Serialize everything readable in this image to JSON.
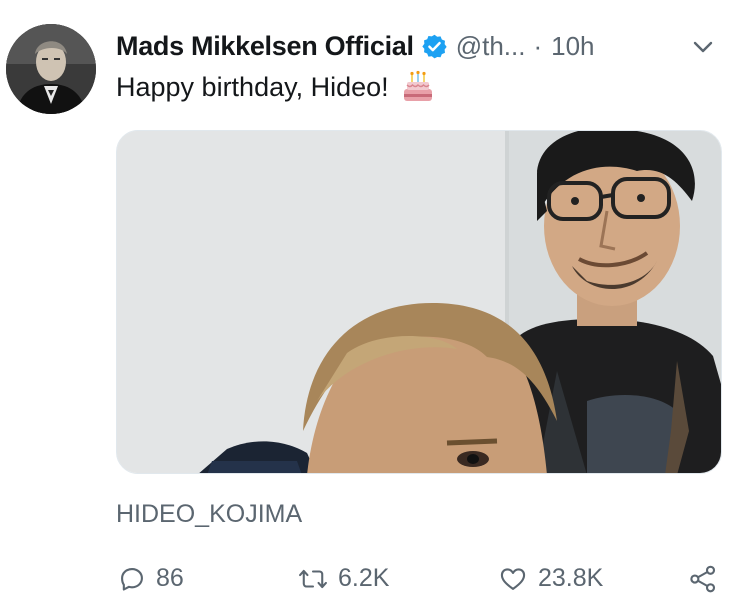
{
  "tweet": {
    "author_name": "Mads Mikkelsen Official",
    "handle": "@th...",
    "separator": "·",
    "time": "10h",
    "text": "Happy birthday, Hideo!",
    "emoji_icon": "birthday-cake-icon",
    "media_caption": "HIDEO_KOJIMA"
  },
  "actions": {
    "reply_count": "86",
    "retweet_count": "6.2K",
    "like_count": "23.8K"
  },
  "colors": {
    "verified": "#1da1f2",
    "muted_text": "#5b6670",
    "text": "#14171a"
  }
}
